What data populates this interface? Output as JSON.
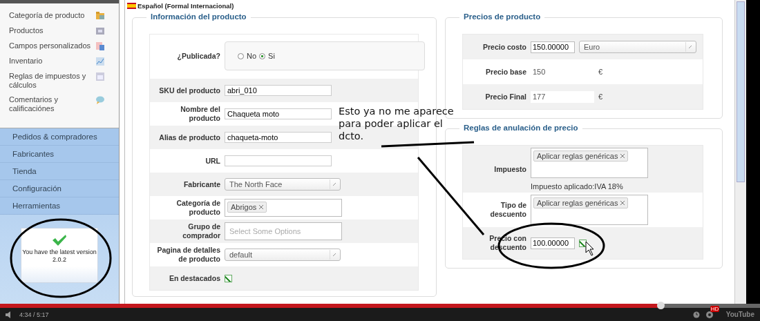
{
  "sidebar": {
    "items": [
      {
        "label": "Categoría de producto"
      },
      {
        "label": "Productos"
      },
      {
        "label": "Campos personalizados"
      },
      {
        "label": "Inventario"
      },
      {
        "label": "Reglas de impuestos y cálculos"
      },
      {
        "label": "Comentarios y calificaciónes"
      }
    ],
    "sections": [
      {
        "label": "Pedidos & compradores"
      },
      {
        "label": "Fabricantes"
      },
      {
        "label": "Tienda"
      },
      {
        "label": "Configuración"
      },
      {
        "label": "Herramientas"
      }
    ],
    "version_notice": {
      "text": "You have the latest version",
      "version": "2.0.2"
    }
  },
  "language": "Español (Formal Internacional)",
  "product_info": {
    "title": "Información del producto",
    "rows": [
      {
        "kind": "radio",
        "label": "¿Publicada?",
        "options": [
          {
            "label": "No",
            "selected": false
          },
          {
            "label": "Si",
            "selected": true
          }
        ]
      },
      {
        "kind": "text",
        "label": "SKU del producto",
        "value": "abri_010"
      },
      {
        "kind": "text",
        "label": "Nombre del producto",
        "value": "Chaqueta moto"
      },
      {
        "kind": "text",
        "label": "Alias de producto",
        "value": "chaqueta-moto"
      },
      {
        "kind": "text",
        "label": "URL",
        "value": ""
      },
      {
        "kind": "select",
        "label": "Fabricante",
        "value": "The North Face"
      },
      {
        "kind": "tags",
        "label": "Categoría de producto",
        "tags": [
          "Abrigos"
        ]
      },
      {
        "kind": "multiselect",
        "label": "Grupo de comprador",
        "placeholder": "Select Some Options"
      },
      {
        "kind": "select",
        "label": "Pagina de detalles de producto",
        "value": "default"
      },
      {
        "kind": "checkbox",
        "label": "En destacados",
        "checked": true
      }
    ]
  },
  "prices": {
    "title": "Precios de producto",
    "rows": [
      {
        "kind": "input_select",
        "label": "Precio costo",
        "value": "150.00000",
        "select": "Euro"
      },
      {
        "kind": "readonly_unit",
        "label": "Precio base",
        "value": "150",
        "unit": "€"
      },
      {
        "kind": "readonly_unit",
        "label": "Precio Final",
        "value": "177",
        "unit": "€"
      }
    ]
  },
  "overrides": {
    "title": "Reglas de anulación de precio",
    "rows": [
      {
        "kind": "tags",
        "label": "Impuesto",
        "tags": [
          "Aplicar reglas genéricas"
        ],
        "note": "Impuesto aplicado:IVA 18%"
      },
      {
        "kind": "tags",
        "label": "Tipo de descuento",
        "tags": [
          "Aplicar reglas genéricas"
        ]
      },
      {
        "kind": "input_checkbox",
        "label": "Precio con descuento",
        "value": "100.00000",
        "checked": true
      }
    ]
  },
  "annotation": {
    "text": "Esto ya no me aparece para poder aplicar el dcto."
  },
  "player": {
    "progress": {
      "level": 0.868
    },
    "time": "4:34 / 5:17",
    "hd_badge": "HD",
    "logo": "YouTube"
  }
}
